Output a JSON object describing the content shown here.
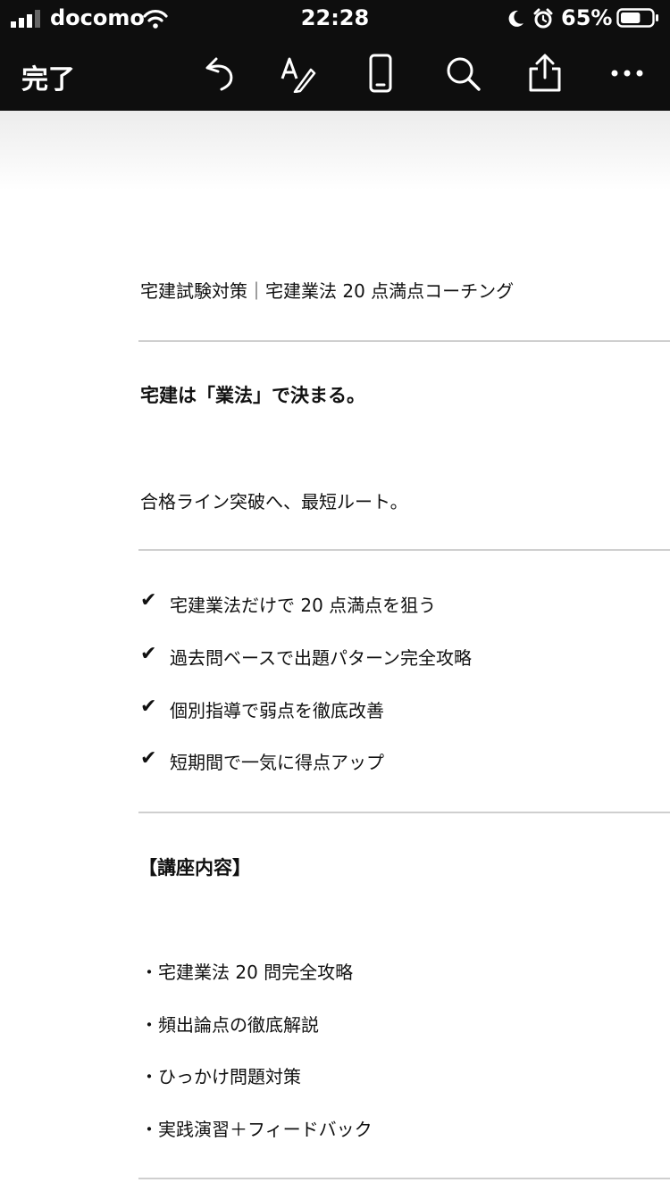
{
  "status_bar": {
    "carrier": "docomo",
    "time": "22:28",
    "battery": "65%",
    "battery_level": 0.65
  },
  "toolbar": {
    "done_label": "完了",
    "icons": [
      "undo-icon",
      "markup-icon",
      "device-icon",
      "search-icon",
      "share-icon",
      "more-icon"
    ]
  },
  "document": {
    "header": "宅建試験対策｜宅建業法 20 点満点コーチング",
    "headline": "宅建は「業法」で決まる。",
    "subhead": "合格ライン突破へ、最短ルート。",
    "check_items": [
      "宅建業法だけで 20 点満点を狙う",
      "過去問ベースで出題パターン完全攻略",
      "個別指導で弱点を徹底改善",
      "短期間で一気に得点アップ"
    ],
    "check_mark": "✔",
    "course_title": "【講座内容】",
    "course_items": [
      "・宅建業法  20 問完全攻略",
      "・頻出論点の徹底解説",
      "・ひっかけ問題対策",
      "・実践演習＋フィードバック"
    ]
  }
}
